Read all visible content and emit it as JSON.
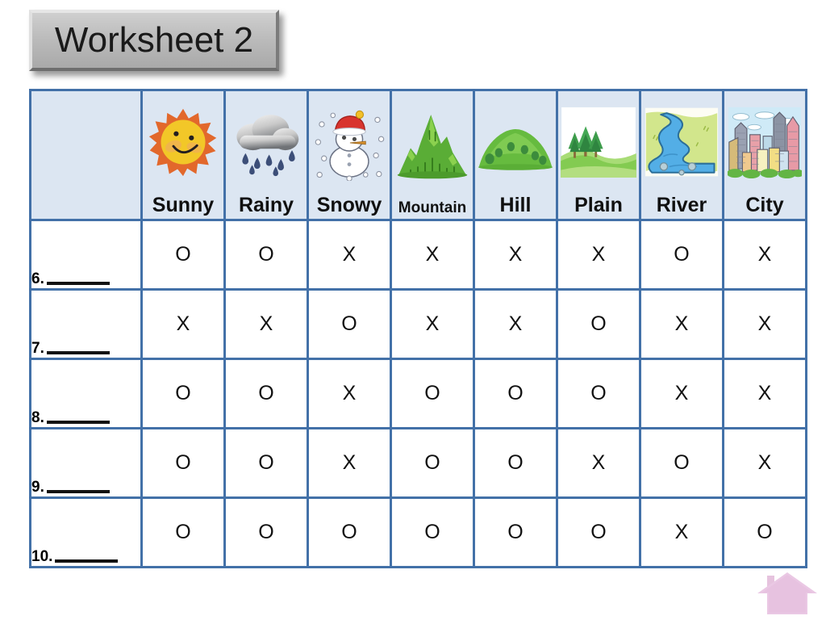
{
  "title": {
    "label": "Worksheet 2"
  },
  "table": {
    "corner_header": "",
    "columns": [
      {
        "label": "Sunny",
        "icon": "sun-icon",
        "label_size": "normal"
      },
      {
        "label": "Rainy",
        "icon": "rain-cloud-icon",
        "label_size": "normal"
      },
      {
        "label": "Snowy",
        "icon": "snowman-icon",
        "label_size": "normal"
      },
      {
        "label": "Mountain",
        "icon": "mountain-icon",
        "label_size": "small"
      },
      {
        "label": "Hill",
        "icon": "hill-icon",
        "label_size": "normal"
      },
      {
        "label": "Plain",
        "icon": "plain-icon",
        "label_size": "normal"
      },
      {
        "label": "River",
        "icon": "river-icon",
        "label_size": "normal"
      },
      {
        "label": "City",
        "icon": "city-icon",
        "label_size": "normal"
      }
    ],
    "rows": [
      {
        "number": "6.",
        "blank": "",
        "marks": [
          "O",
          "O",
          "X",
          "X",
          "X",
          "X",
          "O",
          "X"
        ]
      },
      {
        "number": "7.",
        "blank": "",
        "marks": [
          "X",
          "X",
          "O",
          "X",
          "X",
          "O",
          "X",
          "X"
        ]
      },
      {
        "number": "8.",
        "blank": "",
        "marks": [
          "O",
          "O",
          "X",
          "O",
          "O",
          "O",
          "X",
          "X"
        ]
      },
      {
        "number": "9.",
        "blank": "",
        "marks": [
          "O",
          "O",
          "X",
          "O",
          "O",
          "X",
          "O",
          "X"
        ]
      },
      {
        "number": "10.",
        "blank": "",
        "marks": [
          "O",
          "O",
          "O",
          "O",
          "O",
          "O",
          "X",
          "O"
        ]
      }
    ]
  },
  "home": {
    "icon": "home-icon"
  },
  "colors": {
    "border": "#4371a8",
    "header_bg": "#dce6f2",
    "body_bg": "#ffffff",
    "title_bg": "#bcbcbc",
    "home": "#e8c6e0"
  }
}
